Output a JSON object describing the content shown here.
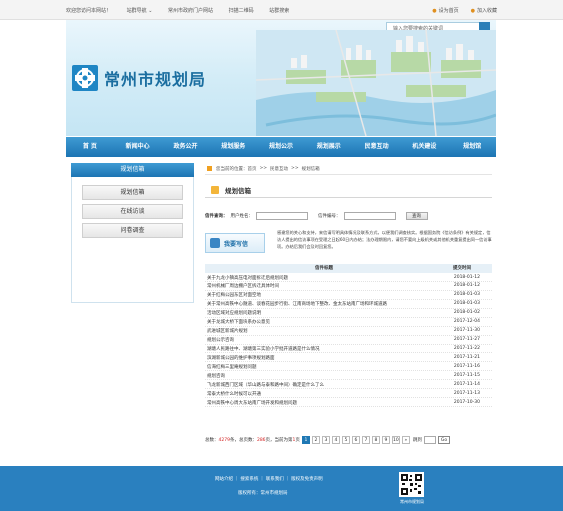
{
  "topbar": {
    "links": [
      "欢迎您访问本网站！",
      "站群导航 ⌄",
      "常州市政府门户网站",
      "扫描二维码",
      "站群搜索"
    ],
    "set_home": "设为首页",
    "add_fav": "加入收藏"
  },
  "banner": {
    "search_placeholder": "输入您要搜索的关键词",
    "site_title": "常州市规划局"
  },
  "nav": [
    "首 页",
    "新闻中心",
    "政务公开",
    "规划服务",
    "规划公示",
    "规划展示",
    "民意互动",
    "机关建设",
    "规划馆"
  ],
  "sidebar": {
    "title": "规划信箱",
    "items": [
      "规划信箱",
      "在线访谈",
      "问卷调查"
    ]
  },
  "breadcrumb": {
    "prefix": "您当前的位置：",
    "items": [
      "首页",
      "民意互动",
      "规划信箱"
    ],
    "separator": ">>"
  },
  "section_title": "规划信箱",
  "query": {
    "label": "信件查询：",
    "user_label": "用户姓名：",
    "number_label": "信件编号：",
    "button": "查询"
  },
  "write_button": "我要写信",
  "notice": "感谢您的关心和支持，来信请写明具体情况及联系方式，以便我们调查核实。根据国务院《信访条例》有关规定，信访人提出的信访事项在受理之日起60日内办结；法办理期限内，请您不要向上级机关或其他机关重复提出同一信访事项。办结后我们会及时回复您。",
  "table": {
    "headers": [
      "信件标题",
      "提交时间"
    ],
    "rows": [
      {
        "title": "关于九龙小镇高压电对面拆迁后规划问题",
        "date": "2018-01-12"
      },
      {
        "title": "常州机械厂周边棚户区拆迁具体时间",
        "date": "2018-01-12"
      },
      {
        "title": "关于红梅公园东区对面空地",
        "date": "2018-01-03"
      },
      {
        "title": "关于常州高铁中心隧道、谈春花园步行街、江南商场地下整改、金太东站南广场和环城道路",
        "date": "2018-01-03"
      },
      {
        "title": "活动区域对应规划问题说明",
        "date": "2018-01-02"
      },
      {
        "title": "关于龙城大桥下面块系办公意见",
        "date": "2017-12-04"
      },
      {
        "title": "武进城区新城片规划",
        "date": "2017-11-30"
      },
      {
        "title": "规划公示咨询",
        "date": "2017-11-27"
      },
      {
        "title": "湖塘人民路往中、湖塘第三实验小学批开道路是什么情况",
        "date": "2017-11-22"
      },
      {
        "title": "滨湖新城公园的维护事项规划路面",
        "date": "2017-11-21"
      },
      {
        "title": "信海红梅三里庵规划问题",
        "date": "2017-11-16"
      },
      {
        "title": "规划咨询",
        "date": "2017-11-15"
      },
      {
        "title": "飞龙新城西门区域（华山路与泰和路中间）确定是什么了么",
        "date": "2017-11-14"
      },
      {
        "title": "常泰大桥什么时候可以开通",
        "date": "2017-11-13"
      },
      {
        "title": "常州高铁中心周大东站南广场开发和规划问题",
        "date": "2017-10-30"
      }
    ]
  },
  "pager": {
    "total_label": "总数：",
    "total": "4279",
    "unit_items": "条，总页数：",
    "pages_total": "286",
    "unit_pages": "页，当前为第",
    "current": "1",
    "unit_page": "页",
    "pages": [
      "1",
      "2",
      "3",
      "4",
      "5",
      "6",
      "7",
      "8",
      "9",
      "10"
    ],
    "next": "»",
    "jump_label": "跳到",
    "go": "Go"
  },
  "footer": {
    "links": "网站介绍 ｜ 搜索系统 ｜ 联系我们 ｜ 版权及免责声明",
    "copyright": "版权所有：常州市规划局",
    "qr_label": "常州市规划局"
  },
  "colors": {
    "brand_blue": "#1c74b3",
    "footer_blue": "#2a80bf",
    "accent_orange": "#f0a020"
  }
}
